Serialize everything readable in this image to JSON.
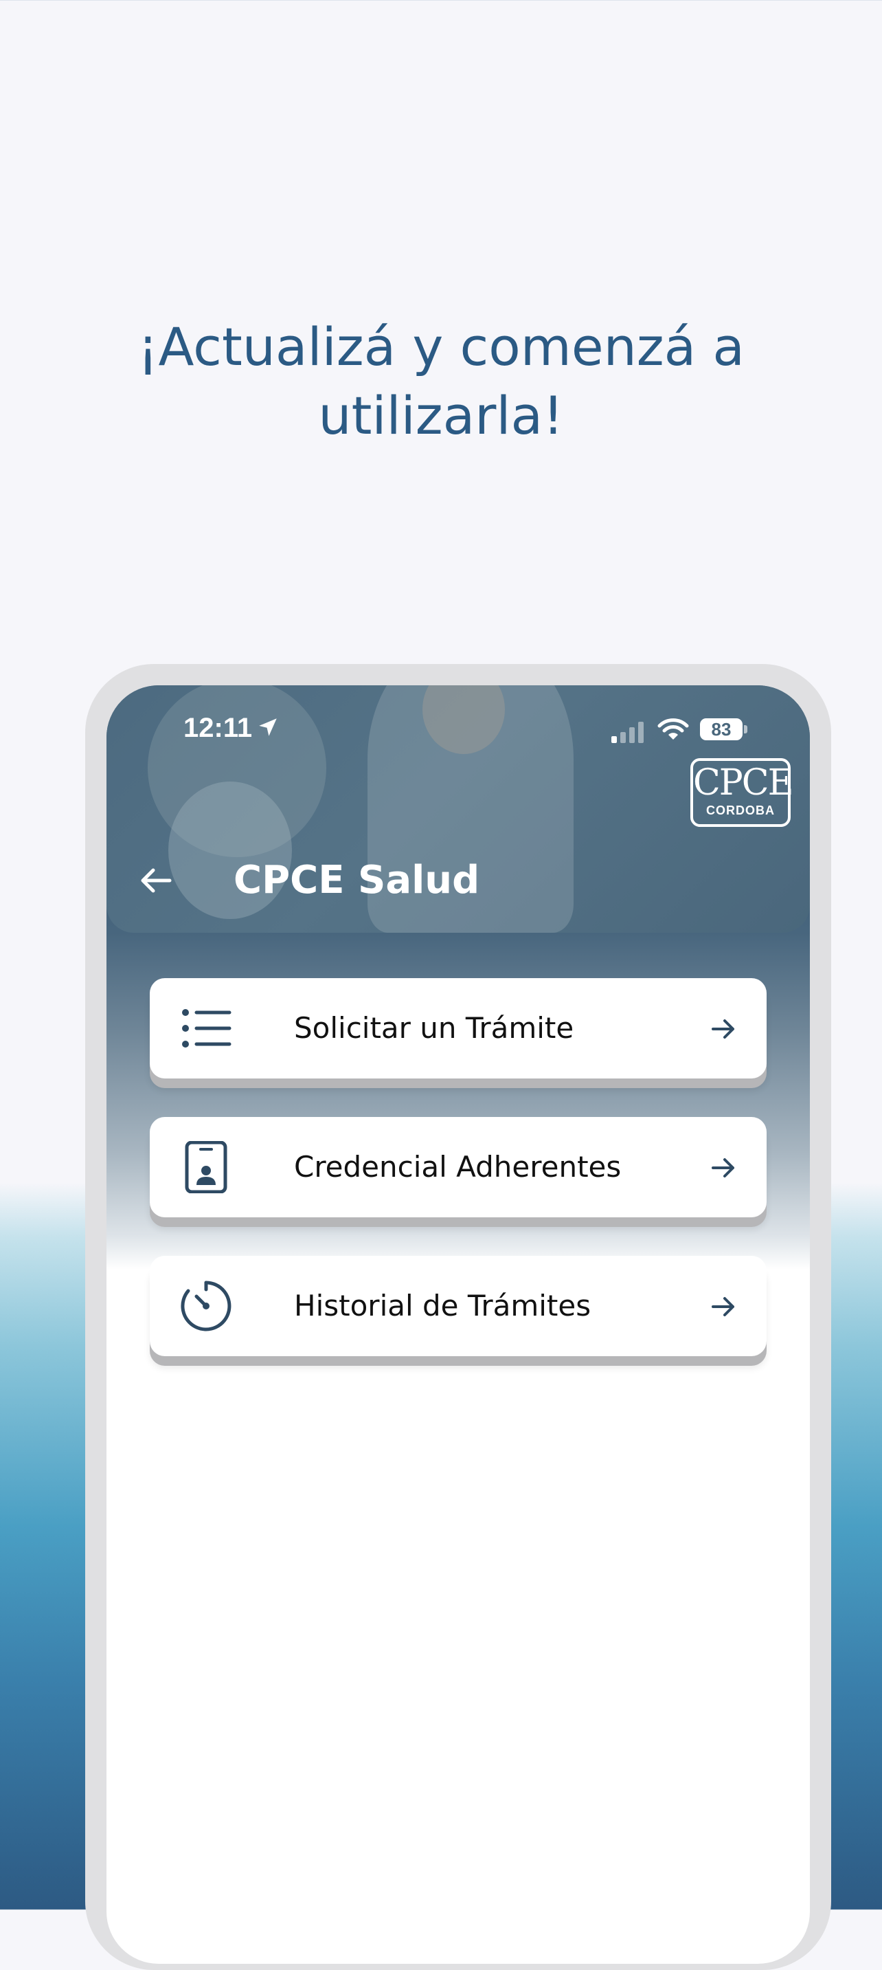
{
  "promo": {
    "headline_line1": "¡Actualizá y comenzá a",
    "headline_line2": "utilizarla!"
  },
  "status_bar": {
    "time": "12:11",
    "battery": "83"
  },
  "logo": {
    "main": "CPCE",
    "sub": "CORDOBA"
  },
  "header": {
    "title": "CPCE Salud"
  },
  "menu": {
    "items": [
      {
        "label": "Solicitar un Trámite",
        "icon": "list-icon"
      },
      {
        "label": "Credencial Adherentes",
        "icon": "id-card-icon"
      },
      {
        "label": "Historial de Trámites",
        "icon": "history-timer-icon"
      }
    ]
  },
  "colors": {
    "headline": "#2b5a84",
    "header_bg": "#4c6a80",
    "icon": "#2e4a63",
    "card_bg": "#ffffff"
  }
}
